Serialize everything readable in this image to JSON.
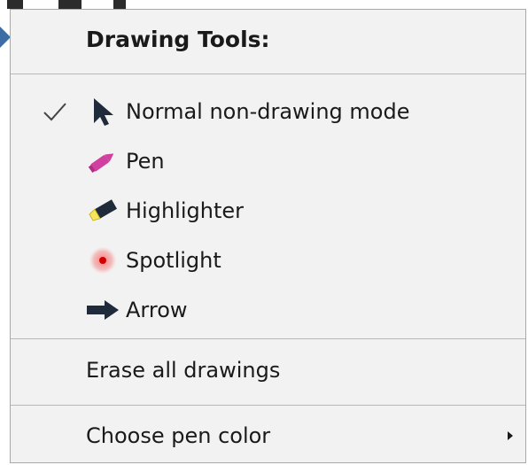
{
  "menu": {
    "header": "Drawing Tools:",
    "tools": [
      {
        "label": "Normal non-drawing mode",
        "icon": "cursor-arrow-icon",
        "checked": true
      },
      {
        "label": "Pen",
        "icon": "pen-icon",
        "checked": false
      },
      {
        "label": "Highlighter",
        "icon": "highlighter-icon",
        "checked": false
      },
      {
        "label": "Spotlight",
        "icon": "spotlight-icon",
        "checked": false
      },
      {
        "label": "Arrow",
        "icon": "arrow-icon",
        "checked": false
      }
    ],
    "erase_label": "Erase all drawings",
    "pen_color_label": "Choose pen color"
  },
  "colors": {
    "menu_bg": "#f2f2f2",
    "pen": "#d13f9f",
    "highlighter": "#f6e65a",
    "spotlight": "#e03a3a",
    "icon_dark": "#1f2a3a"
  }
}
